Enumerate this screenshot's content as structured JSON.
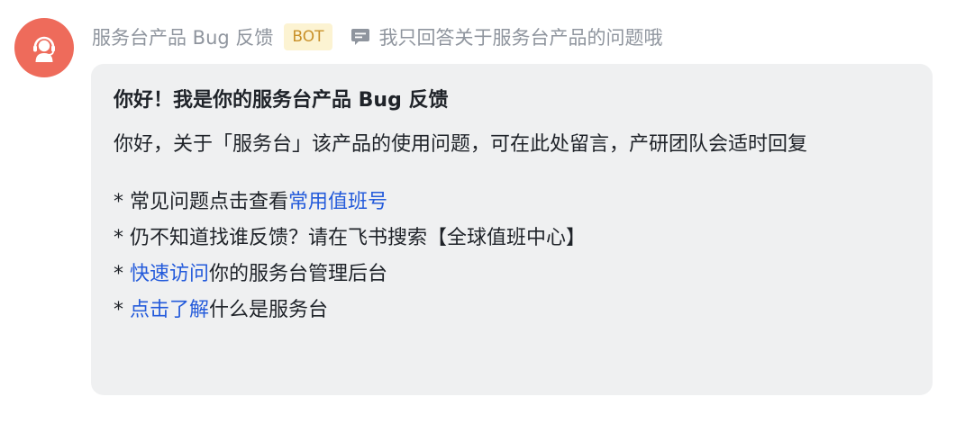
{
  "sender": {
    "name": "服务台产品 Bug 反馈",
    "badge": "BOT",
    "description": "我只回答关于服务台产品的问题哦",
    "avatar_icon": "headset-agent-icon",
    "description_icon": "message-icon"
  },
  "colors": {
    "avatar_bg": "#ee6b5b",
    "link": "#245bdb",
    "badge_bg": "#fcf3d2",
    "badge_text": "#c9912a",
    "card_bg": "#eff0f1"
  },
  "card": {
    "title": "你好！我是你的服务台产品 Bug 反馈",
    "intro": "你好，关于「服务台」该产品的使用问题，可在此处留言，产研团队会适时回复",
    "bullets": [
      {
        "prefix": "* 常见问题点击查看",
        "link": "常用值班号",
        "suffix": ""
      },
      {
        "prefix": "* 仍不知道找谁反馈？请在飞书搜索【全球值班中心】",
        "link": "",
        "suffix": ""
      },
      {
        "prefix": "* ",
        "link": "快速访问",
        "suffix": "你的服务台管理后台"
      },
      {
        "prefix": "* ",
        "link": "点击了解",
        "suffix": "什么是服务台"
      }
    ]
  }
}
